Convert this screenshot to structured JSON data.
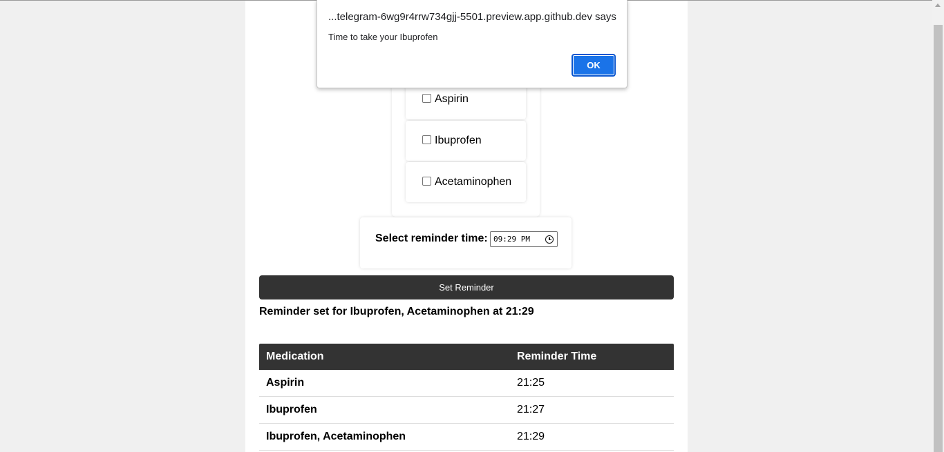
{
  "medications": [
    {
      "label": "Aspirin"
    },
    {
      "label": "Ibuprofen"
    },
    {
      "label": "Acetaminophen"
    }
  ],
  "time_picker": {
    "label": "Select reminder time:",
    "value": "09:29 PM"
  },
  "set_button_label": "Set Reminder",
  "reminder_message": "Reminder set for Ibuprofen, Acetaminophen at 21:29",
  "table": {
    "headers": [
      "Medication",
      "Reminder Time"
    ],
    "rows": [
      {
        "medication": "Aspirin",
        "time": "21:25"
      },
      {
        "medication": "Ibuprofen",
        "time": "21:27"
      },
      {
        "medication": "Ibuprofen, Acetaminophen",
        "time": "21:29"
      }
    ]
  },
  "dialog": {
    "origin": "...telegram-6wg9r4rrw734gjj-5501.preview.app.github.dev says",
    "message": "Time to take your Ibuprofen",
    "ok_label": "OK"
  },
  "colors": {
    "dark_button": "#333333",
    "dialog_button": "#1a73e8"
  }
}
